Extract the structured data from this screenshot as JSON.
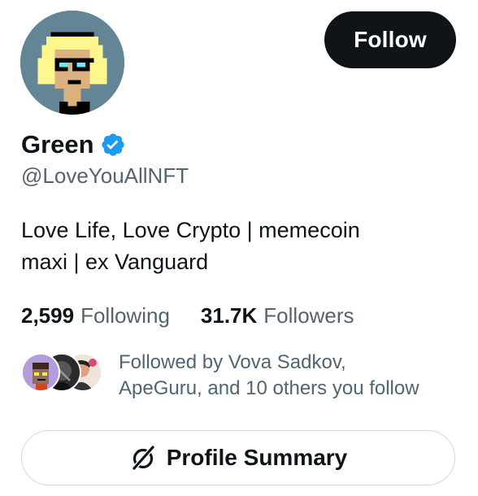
{
  "profile": {
    "name": "Green",
    "handle": "@LoveYouAllNFT",
    "verified": true,
    "bio_lines": [
      "Love Life, Love Crypto | memecoin",
      "maxi | ex Vanguard"
    ],
    "avatar_icon": "pixel-punk-avatar"
  },
  "actions": {
    "follow_label": "Follow",
    "profile_summary_label": "Profile Summary",
    "profile_summary_icon": "grok-slash-circle-icon"
  },
  "stats": {
    "following_count": "2,599",
    "following_label": "Following",
    "followers_count": "31.7K",
    "followers_label": "Followers"
  },
  "followed_by": {
    "line1": "Followed by Vova Sadkov,",
    "line2": "ApeGuru, and 10 others you follow"
  },
  "colors": {
    "primary_text": "#0f1419",
    "secondary_text": "#536471",
    "follow_bg": "#0f1419",
    "verified_blue": "#1d9bf0",
    "border": "#cfd9de",
    "avatar_bg": "#638596"
  }
}
